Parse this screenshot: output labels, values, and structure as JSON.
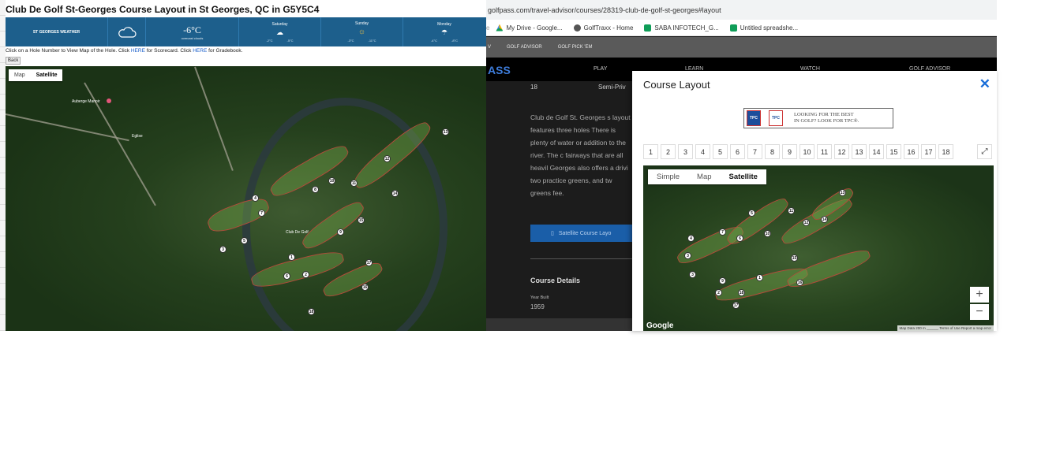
{
  "left": {
    "title": "Club De Golf St-Georges Course Layout in St Georges, QC in G5Y5C4",
    "weather": {
      "brand": "ST GEORGES WEATHER",
      "current_temp": "-6°C",
      "current_desc": "overcast clouds",
      "days": [
        {
          "name": "Saturday",
          "icon": "cloud-icon",
          "high": "-2°C",
          "low": "-5°C"
        },
        {
          "name": "Sunday",
          "icon": "sun-icon",
          "high": "-3°C",
          "low": "-11°C"
        },
        {
          "name": "Monday",
          "icon": "rain-icon",
          "high": "-4°C",
          "low": "-8°C"
        }
      ]
    },
    "instructions_pre": "Click on a Hole Number to View Map of the Hole. Click ",
    "link1": "HERE",
    "instructions_mid": " for Scorecard. Click ",
    "link2": "HERE",
    "instructions_post": " for Gradebook.",
    "back_label": "Back",
    "map_tabs": [
      "Map",
      "Satellite"
    ],
    "places": [
      "Auberge Manoir",
      "Eglise",
      "Club De Golf"
    ]
  },
  "browser": {
    "url": "golfpass.com/travel-advisor/courses/28319-club-de-golf-st-georges#layout",
    "bookmarks": [
      "My Drive - Google...",
      "GolfTraxx - Home",
      "SABA INFOTECH_G...",
      "Untitled spreadshe..."
    ],
    "site_nav": [
      "V",
      "GOLF ADVISOR",
      "GOLF PICK 'EM"
    ],
    "brand_fragment": "ASS",
    "menu": [
      "PLAY",
      "LEARN",
      "WATCH",
      "GOLF ADVISOR"
    ],
    "holes_count": "18",
    "access": "Semi-Priv",
    "description": "Club de Golf St. Georges s layout features three holes There is plenty of water or addition to the river. The c fairways that are all heavil Georges also offers a drivi two practice greens, and tw greens fee.",
    "satellite_button": "Satellite Course Layo",
    "course_details": "Course Details",
    "year_built_label": "Year Built",
    "year_built": "1959"
  },
  "modal": {
    "title": "Course Layout",
    "ad_text_line1": "LOOKING FOR THE BEST",
    "ad_text_line2": "IN GOLF? LOOK FOR TPC®.",
    "holes": [
      "1",
      "2",
      "3",
      "4",
      "5",
      "6",
      "7",
      "8",
      "9",
      "10",
      "11",
      "12",
      "13",
      "14",
      "15",
      "16",
      "17",
      "18"
    ],
    "map_tabs": [
      "Simple",
      "Map",
      "Satellite"
    ],
    "zoom_in": "+",
    "zoom_out": "−",
    "google": "Google",
    "attribution": "Map Data  200 m ______  Terms of Use  Report a map error"
  }
}
